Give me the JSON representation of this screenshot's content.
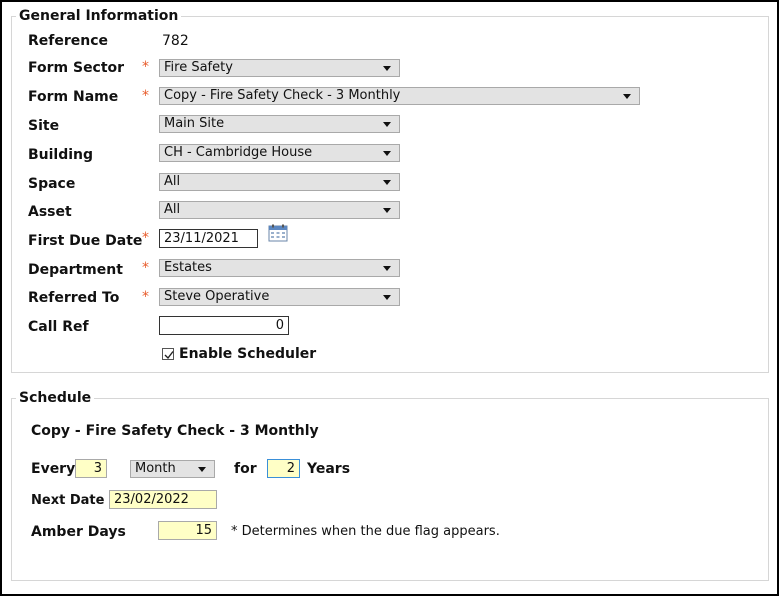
{
  "general": {
    "legend": "General Information",
    "reference": {
      "label": "Reference",
      "value": "782"
    },
    "form_sector": {
      "label": "Form Sector",
      "value": "Fire Safety"
    },
    "form_name": {
      "label": "Form Name",
      "value": "Copy - Fire Safety Check - 3 Monthly"
    },
    "site": {
      "label": "Site",
      "value": "Main Site"
    },
    "building": {
      "label": "Building",
      "value": "CH - Cambridge House"
    },
    "space": {
      "label": "Space",
      "value": "All"
    },
    "asset": {
      "label": "Asset",
      "value": "All"
    },
    "first_due_date": {
      "label": "First Due Date",
      "value": "23/11/2021"
    },
    "department": {
      "label": "Department",
      "value": "Estates"
    },
    "referred_to": {
      "label": "Referred To",
      "value": "Steve Operative"
    },
    "call_ref": {
      "label": "Call Ref",
      "value": "0"
    },
    "enable_scheduler": {
      "label": "Enable Scheduler",
      "checked": true
    },
    "required_mark": "*"
  },
  "schedule": {
    "legend": "Schedule",
    "title": "Copy - Fire Safety Check - 3 Monthly",
    "every_label": "Every",
    "every_value": "3",
    "unit_value": "Month",
    "for_label": "for",
    "for_value": "2",
    "years_label": "Years",
    "next_date_label": "Next Date",
    "next_date_value": "23/02/2022",
    "amber_days_label": "Amber Days",
    "amber_days_value": "15",
    "amber_note": "* Determines when the due flag appears."
  },
  "colors": {
    "required": "#e85c2b",
    "highlight_field": "#ffffc6",
    "select_bg": "#e3e3e3"
  },
  "icons": {
    "calendar": "calendar-icon",
    "dropdown": "chevron-down-icon",
    "check": "check-icon"
  }
}
